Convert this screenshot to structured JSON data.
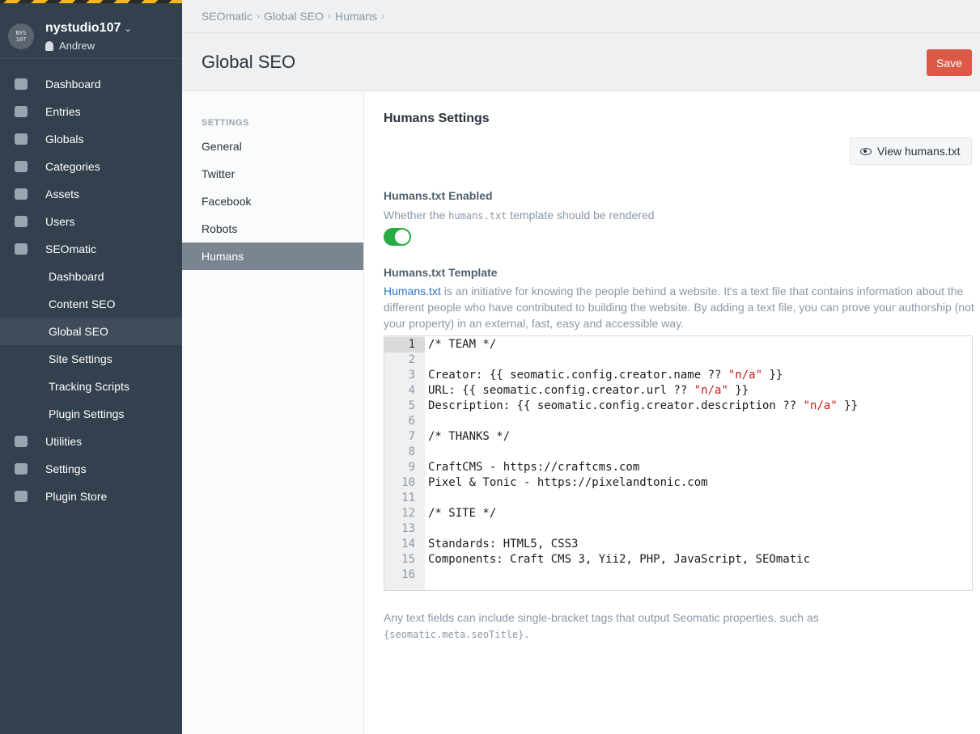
{
  "site": {
    "name": "nystudio107",
    "logo_text": "NYS\n107",
    "user": "Andrew"
  },
  "nav": [
    {
      "label": "Dashboard",
      "icon": "dashboard-icon"
    },
    {
      "label": "Entries",
      "icon": "entries-icon"
    },
    {
      "label": "Globals",
      "icon": "globe-icon"
    },
    {
      "label": "Categories",
      "icon": "folder-icon"
    },
    {
      "label": "Assets",
      "icon": "image-icon"
    },
    {
      "label": "Users",
      "icon": "users-icon"
    },
    {
      "label": "SEOmatic",
      "icon": "seomatic-icon"
    }
  ],
  "seomatic_sub": [
    "Dashboard",
    "Content SEO",
    "Global SEO",
    "Site Settings",
    "Tracking Scripts",
    "Plugin Settings"
  ],
  "nav_bottom": [
    {
      "label": "Utilities",
      "icon": "wrench-icon"
    },
    {
      "label": "Settings",
      "icon": "gear-icon"
    },
    {
      "label": "Plugin Store",
      "icon": "plug-icon"
    }
  ],
  "breadcrumbs": [
    "SEOmatic",
    "Global SEO",
    "Humans"
  ],
  "page": {
    "title": "Global SEO",
    "save_label": "Save"
  },
  "subnav": {
    "heading": "SETTINGS",
    "items": [
      "General",
      "Twitter",
      "Facebook",
      "Robots",
      "Humans"
    ],
    "active": "Humans"
  },
  "panel": {
    "title": "Humans Settings",
    "view_button": "View humans.txt",
    "enabled_label": "Humans.txt Enabled",
    "enabled_desc_pre": "Whether the ",
    "enabled_desc_code": "humans.txt",
    "enabled_desc_post": " template should be rendered",
    "enabled": true,
    "template_label": "Humans.txt Template",
    "template_link": "Humans.txt",
    "template_desc": " is an initiative for knowing the people behind a website. It's a text file that contains information about the different people who have contributed to building the website. By adding a text file, you can prove your authorship (not your property) in an external, fast, easy and accessible way.",
    "footnote_text": "Any text fields can include single-bracket tags that output Seomatic properties, such as",
    "footnote_code": "{seomatic.meta.seoTitle}."
  },
  "code_lines": [
    "/* TEAM */",
    "",
    "Creator: {{ seomatic.config.creator.name ?? \"n/a\" }}",
    "URL: {{ seomatic.config.creator.url ?? \"n/a\" }}",
    "Description: {{ seomatic.config.creator.description ?? \"n/a\" }}",
    "",
    "/* THANKS */",
    "",
    "CraftCMS - https://craftcms.com",
    "Pixel & Tonic - https://pixelandtonic.com",
    "",
    "/* SITE */",
    "",
    "Standards: HTML5, CSS3",
    "Components: Craft CMS 3, Yii2, PHP, JavaScript, SEOmatic",
    ""
  ],
  "colors": {
    "save": "#da5a47",
    "toggle_on": "#27ab42",
    "link": "#2a76c9",
    "sidebar": "#33404d"
  }
}
